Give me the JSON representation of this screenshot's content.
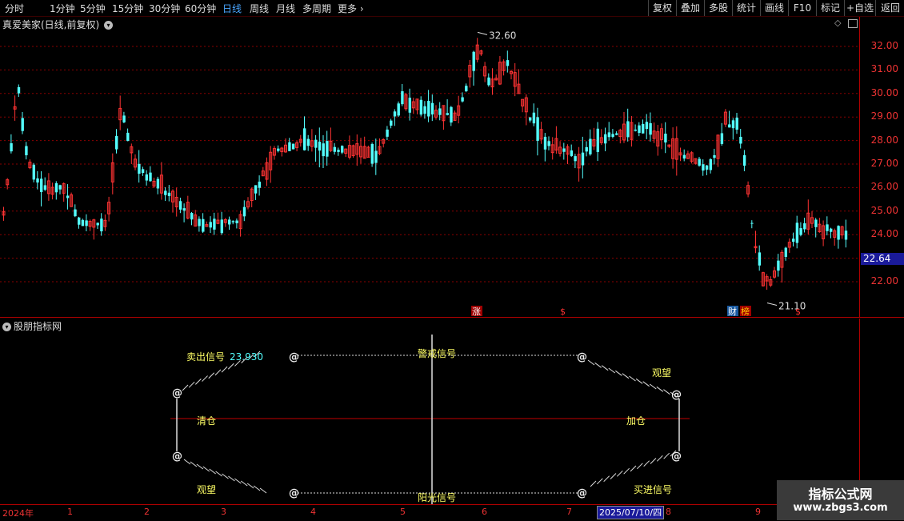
{
  "toolbar": {
    "periods": [
      "分时",
      "1分钟",
      "5分钟",
      "15分钟",
      "30分钟",
      "60分钟",
      "日线",
      "周线",
      "月线",
      "多周期",
      "更多"
    ],
    "active_period": "日线",
    "right_buttons": [
      "复权",
      "叠加",
      "多股",
      "统计",
      "画线",
      "F10",
      "标记",
      "+自选",
      "返回"
    ]
  },
  "main_chart": {
    "title": "真爱美家(日线,前复权)",
    "price_labels": [
      "32.00",
      "31.00",
      "30.00",
      "29.00",
      "28.00",
      "27.00",
      "26.00",
      "25.00",
      "24.00",
      "23.00",
      "22.00"
    ],
    "current_price": "22.64",
    "high_marker": "32.60",
    "low_marker": "21.10",
    "event_markers": [
      {
        "text": "涨",
        "color": "#ffffff",
        "bg": "#a00000"
      },
      {
        "text": "$",
        "color": "#ff3333"
      },
      {
        "text": "财",
        "color": "#ffffff",
        "bg": "#1a5aa0"
      },
      {
        "text": "榜",
        "color": "#ffcc00",
        "bg": "#a00000"
      },
      {
        "text": "$",
        "color": "#ff3333"
      }
    ],
    "colors": {
      "up": "#ff3333",
      "down": "#54ffff",
      "grid": "#8b0000"
    }
  },
  "chart_data": {
    "type": "candlestick",
    "high": 32.6,
    "low": 21.1,
    "ylim": [
      21.0,
      33.0
    ],
    "yticks": [
      22,
      23,
      24,
      25,
      26,
      27,
      28,
      29,
      30,
      31,
      32
    ],
    "last_close": 22.64
  },
  "indicator": {
    "title": "股朋指标网",
    "labels": {
      "sell_signal": "卖出信号",
      "sell_value": "23.930",
      "warning": "警戒信号",
      "watch_top": "观望",
      "clear": "清仓",
      "add": "加仓",
      "watch_bottom": "观望",
      "sunshine": "阳光信号",
      "buy_signal": "买进信号"
    },
    "at_symbol": "@"
  },
  "date_axis": {
    "year": "2024年",
    "months": [
      "1",
      "2",
      "3",
      "4",
      "5",
      "6",
      "7",
      "8",
      "9"
    ],
    "cursor_date": "2025/07/10/四"
  },
  "watermark": {
    "title": "指标公式网",
    "url": "www.zbgs3.com"
  }
}
